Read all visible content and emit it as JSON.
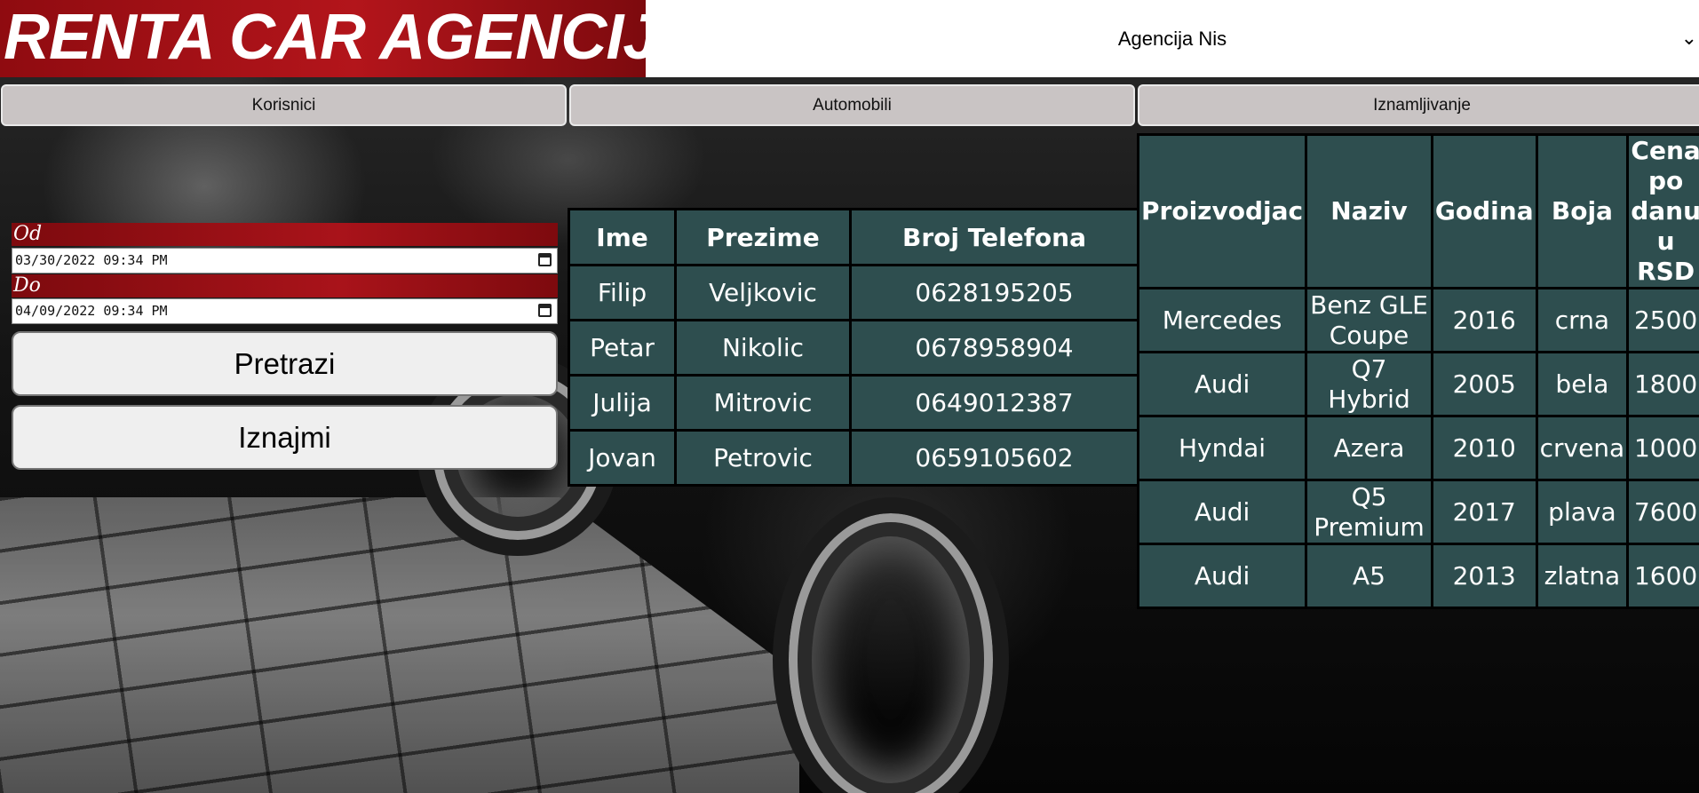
{
  "header": {
    "logo_text": "RENTA CAR AGENCIJA",
    "agency_selected": "Agencija Nis"
  },
  "nav": {
    "users_label": "Korisnici",
    "cars_label": "Automobili",
    "rent_label": "Iznamljivanje"
  },
  "form": {
    "from_label": "Od",
    "from_value": "03/30/2022 09:34 PM",
    "to_label": "Do",
    "to_value": "04/09/2022 09:34 PM",
    "search_label": "Pretrazi",
    "rent_label": "Iznajmi"
  },
  "users_table": {
    "headers": [
      "Ime",
      "Prezime",
      "Broj Telefona"
    ],
    "rows": [
      [
        "Filip",
        "Veljkovic",
        "0628195205"
      ],
      [
        "Petar",
        "Nikolic",
        "0678958904"
      ],
      [
        "Julija",
        "Mitrovic",
        "0649012387"
      ],
      [
        "Jovan",
        "Petrovic",
        "0659105602"
      ]
    ]
  },
  "cars_table": {
    "headers": [
      "Proizvodjac",
      "Naziv",
      "Godina",
      "Boja",
      "Cena po danu u RSD"
    ],
    "rows": [
      [
        "Mercedes",
        "Benz GLE Coupe",
        "2016",
        "crna",
        "2500"
      ],
      [
        "Audi",
        "Q7 Hybrid",
        "2005",
        "bela",
        "1800"
      ],
      [
        "Hyndai",
        "Azera",
        "2010",
        "crvena",
        "1000"
      ],
      [
        "Audi",
        "Q5 Premium",
        "2017",
        "plava",
        "7600"
      ],
      [
        "Audi",
        "A5",
        "2013",
        "zlatna",
        "1600"
      ]
    ]
  }
}
